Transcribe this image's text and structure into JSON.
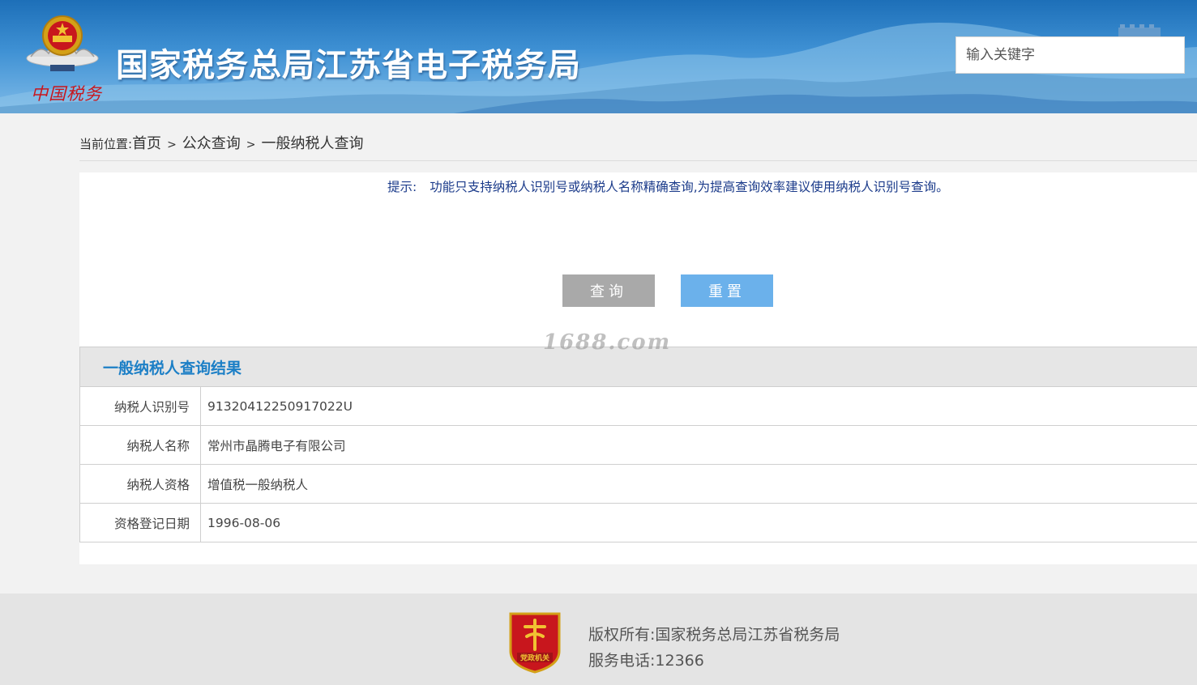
{
  "header": {
    "site_title": "国家税务总局江苏省电子税务局",
    "motto": "中国税务",
    "search_placeholder": "输入关键字"
  },
  "breadcrumb": {
    "label": "当前位置:",
    "items": [
      "首页",
      "公众查询",
      "一般纳税人查询"
    ],
    "separator": ">"
  },
  "hint": {
    "label": "提示:",
    "text": "功能只支持纳税人识别号或纳税人名称精确查询,为提高查询效率建议使用纳税人识别号查询。"
  },
  "buttons": {
    "query": "查询",
    "reset": "重置"
  },
  "watermark": "1688.com",
  "result": {
    "title": "一般纳税人查询结果",
    "rows": [
      {
        "label": "纳税人识别号",
        "value": "91320412250917022U"
      },
      {
        "label": "纳税人名称",
        "value": "常州市晶腾电子有限公司"
      },
      {
        "label": "纳税人资格",
        "value": "增值税一般纳税人"
      },
      {
        "label": "资格登记日期",
        "value": "1996-08-06"
      }
    ]
  },
  "footer": {
    "badge_text": "党政机关",
    "copyright": "版权所有:国家税务总局江苏省税务局",
    "phone": "服务电话:12366"
  },
  "colors": {
    "header_blue": "#1d6fb8",
    "result_title": "#1c7fc6",
    "hint_text": "#1a3a8a",
    "query_button": "#a9a9a9",
    "reset_button": "#6bb1eb",
    "emblem_red": "#c8161d"
  }
}
